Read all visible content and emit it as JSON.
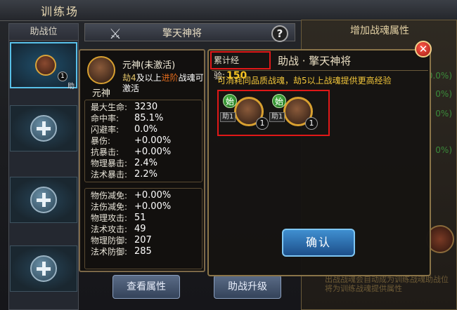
{
  "scene": {
    "title": "训练场",
    "left_header": "助战位",
    "mid_tab": "擎天神将",
    "right_header": "增加战魂属性",
    "right_pcts": [
      "0.0%)",
      "0%)",
      "0%)",
      "0%)"
    ],
    "right_footer": "出战战魂会自动成为训练战魂助战位将为训练战魂提供属性",
    "bottom_buttons": [
      "查看属性",
      "助战升级"
    ],
    "slot1_level": "1",
    "slot1_badge": "助"
  },
  "tooltip": {
    "name": "元神(未激活)",
    "tag": "元神",
    "note_pre": "劫4",
    "note_mid": "及以上",
    "note_em": "进阶",
    "note_post": "战魂可激活",
    "stats_a": [
      {
        "k": "最大生命:",
        "v": "3230"
      },
      {
        "k": "命中率:",
        "v": "85.1%"
      },
      {
        "k": "闪避率:",
        "v": "0.0%"
      },
      {
        "k": "暴伤:",
        "v": "+0.00%"
      },
      {
        "k": "抗暴击:",
        "v": "+0.00%"
      },
      {
        "k": "物理暴击:",
        "v": "2.4%"
      },
      {
        "k": "法术暴击:",
        "v": "2.2%"
      }
    ],
    "stats_b": [
      {
        "k": "物伤减免:",
        "v": "+0.00%"
      },
      {
        "k": "法伤减免:",
        "v": "+0.00%"
      },
      {
        "k": "物理攻击:",
        "v": "51"
      },
      {
        "k": "法术攻击:",
        "v": "49"
      },
      {
        "k": "物理防御:",
        "v": "207"
      },
      {
        "k": "法术防御:",
        "v": "285"
      }
    ]
  },
  "dialog": {
    "exp_label": "累计经验:",
    "exp_value": "150",
    "title": "助战 · 擎天神将",
    "hint": "可消耗同品质战魂，劫5以上战魂提供更高经验",
    "cards": [
      {
        "tag": "始",
        "assist": "助1",
        "level": "1"
      },
      {
        "tag": "始",
        "assist": "助1",
        "level": "1"
      }
    ],
    "confirm": "确认",
    "close": "✕"
  },
  "icons": {
    "crossed": "crossed-swords-icon",
    "help": "help-icon",
    "close": "close-icon",
    "add": "add-icon"
  },
  "colors": {
    "accent_gold": "#f3c222",
    "highlight_red": "#e01818",
    "confirm_blue": "#3f8fd0"
  }
}
